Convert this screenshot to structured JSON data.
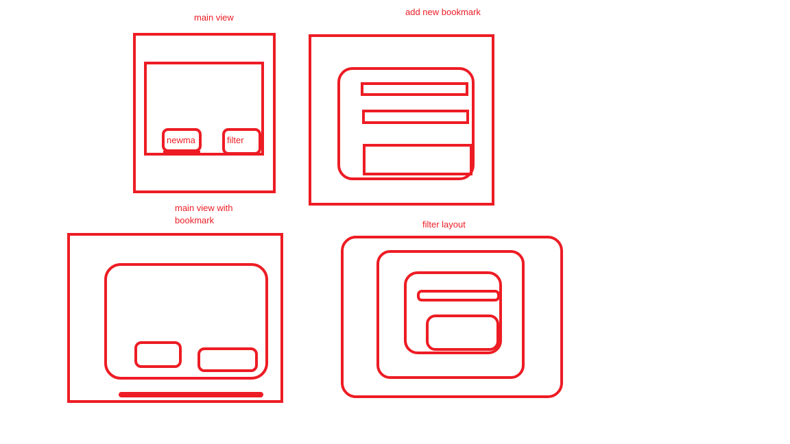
{
  "sketches": {
    "main_view": {
      "title": "main view",
      "buttons": {
        "new": "newma",
        "filter": "filter"
      }
    },
    "add_new_bookmark": {
      "title": "add new bookmark"
    },
    "main_view_with_bookmark": {
      "title_line1": "main view with",
      "title_line2": "bookmark"
    },
    "filter_layout": {
      "title": "filter layout"
    }
  },
  "colors": {
    "stroke": "#ed1c24",
    "background": "#ffffff"
  }
}
